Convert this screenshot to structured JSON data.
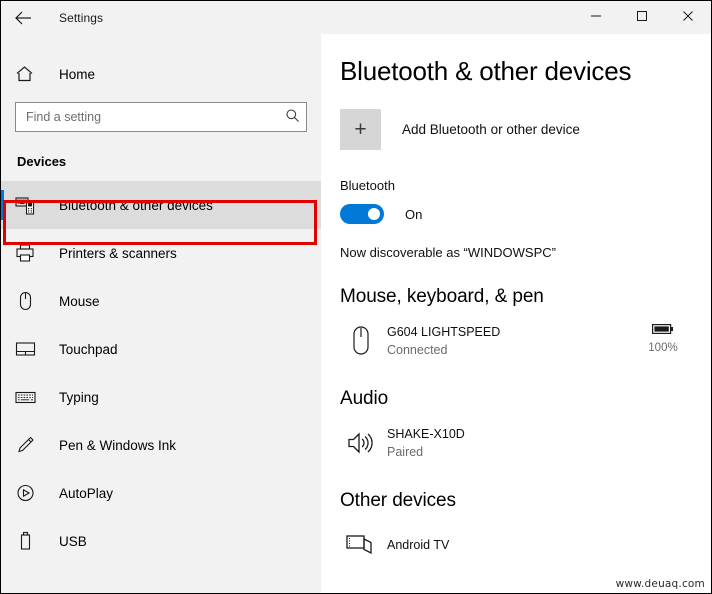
{
  "window": {
    "title": "Settings",
    "back_icon": "back-arrow-icon",
    "minimize_label": "—",
    "maximize_label": "☐",
    "close_label": "✕"
  },
  "sidebar": {
    "home_label": "Home",
    "home_icon": "home-icon",
    "search": {
      "placeholder": "Find a setting",
      "value": "",
      "icon": "search-icon"
    },
    "category_heading": "Devices",
    "items": [
      {
        "label": "Bluetooth & other devices",
        "icon": "bluetooth-devices-icon",
        "selected": true
      },
      {
        "label": "Printers & scanners",
        "icon": "printer-icon",
        "selected": false
      },
      {
        "label": "Mouse",
        "icon": "mouse-icon",
        "selected": false
      },
      {
        "label": "Touchpad",
        "icon": "touchpad-icon",
        "selected": false
      },
      {
        "label": "Typing",
        "icon": "keyboard-icon",
        "selected": false
      },
      {
        "label": "Pen & Windows Ink",
        "icon": "pen-icon",
        "selected": false
      },
      {
        "label": "AutoPlay",
        "icon": "autoplay-icon",
        "selected": false
      },
      {
        "label": "USB",
        "icon": "usb-icon",
        "selected": false
      }
    ]
  },
  "main": {
    "page_title": "Bluetooth & other devices",
    "add_device": {
      "label": "Add Bluetooth or other device",
      "icon": "plus-icon"
    },
    "bluetooth": {
      "label": "Bluetooth",
      "toggle_state": "On",
      "toggle_on": true,
      "discoverable_text": "Now discoverable as “WINDOWSPC”"
    },
    "groups": [
      {
        "heading": "Mouse, keyboard, & pen",
        "devices": [
          {
            "name": "G604 LIGHTSPEED",
            "status": "Connected",
            "icon": "mouse-icon",
            "battery": "100%",
            "battery_icon": "battery-full-icon"
          }
        ]
      },
      {
        "heading": "Audio",
        "devices": [
          {
            "name": "SHAKE-X10D",
            "status": "Paired",
            "icon": "speaker-icon",
            "battery": "",
            "battery_icon": ""
          }
        ]
      },
      {
        "heading": "Other devices",
        "devices": [
          {
            "name": "Android TV",
            "status": "",
            "icon": "tv-icon",
            "battery": "",
            "battery_icon": ""
          }
        ]
      }
    ]
  },
  "watermark": {
    "text": "www.deuaq.com"
  },
  "colors": {
    "accent": "#0078d7",
    "annotation": "#e00000",
    "sidebar_bg": "#f2f2f2",
    "content_bg": "#ffffff"
  }
}
